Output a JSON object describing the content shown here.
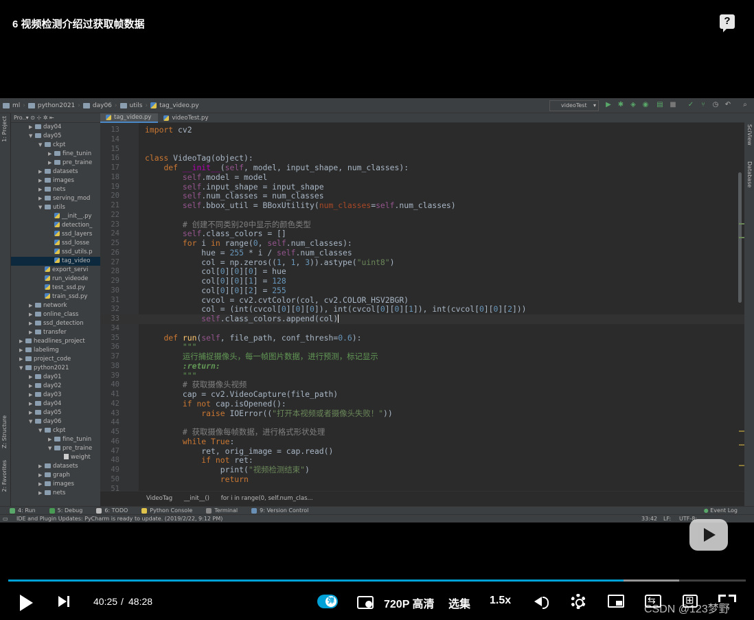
{
  "video": {
    "title": "6 视频检测介绍过获取帧数据",
    "help_label": "?"
  },
  "ide": {
    "breadcrumbs": [
      "ml",
      "python2021",
      "day06",
      "utils",
      "tag_video.py"
    ],
    "run_config": "videoTest",
    "project_header": "Pro..▾",
    "side_tabs": {
      "project": "1: Project",
      "structure": "Z: Structure",
      "favorites": "2: Favorites",
      "sciview": "SciView",
      "database": "Database"
    },
    "tree": [
      {
        "label": "day04",
        "depth": 2,
        "type": "folder",
        "arrow": "▶"
      },
      {
        "label": "day05",
        "depth": 2,
        "type": "folder",
        "arrow": "▼"
      },
      {
        "label": "ckpt",
        "depth": 3,
        "type": "folder",
        "arrow": "▼"
      },
      {
        "label": "fine_tunin",
        "depth": 4,
        "type": "folder",
        "arrow": "▶"
      },
      {
        "label": "pre_traine",
        "depth": 4,
        "type": "folder",
        "arrow": "▶"
      },
      {
        "label": "datasets",
        "depth": 3,
        "type": "folder",
        "arrow": "▶"
      },
      {
        "label": "images",
        "depth": 3,
        "type": "folder",
        "arrow": "▶"
      },
      {
        "label": "nets",
        "depth": 3,
        "type": "folder",
        "arrow": "▶"
      },
      {
        "label": "serving_mod",
        "depth": 3,
        "type": "folder",
        "arrow": "▶"
      },
      {
        "label": "utils",
        "depth": 3,
        "type": "folder",
        "arrow": "▼"
      },
      {
        "label": "__init__.py",
        "depth": 4,
        "type": "py",
        "arrow": ""
      },
      {
        "label": "detection_",
        "depth": 4,
        "type": "py",
        "arrow": ""
      },
      {
        "label": "ssd_layers",
        "depth": 4,
        "type": "py",
        "arrow": ""
      },
      {
        "label": "ssd_losse",
        "depth": 4,
        "type": "py",
        "arrow": ""
      },
      {
        "label": "ssd_utils.p",
        "depth": 4,
        "type": "py",
        "arrow": ""
      },
      {
        "label": "tag_video",
        "depth": 4,
        "type": "py",
        "arrow": "",
        "selected": true
      },
      {
        "label": "export_servi",
        "depth": 3,
        "type": "py",
        "arrow": ""
      },
      {
        "label": "run_videode",
        "depth": 3,
        "type": "py",
        "arrow": ""
      },
      {
        "label": "test_ssd.py",
        "depth": 3,
        "type": "py",
        "arrow": ""
      },
      {
        "label": "train_ssd.py",
        "depth": 3,
        "type": "py",
        "arrow": ""
      },
      {
        "label": "network",
        "depth": 2,
        "type": "folder",
        "arrow": "▶"
      },
      {
        "label": "online_class",
        "depth": 2,
        "type": "folder",
        "arrow": "▶"
      },
      {
        "label": "ssd_detection",
        "depth": 2,
        "type": "folder",
        "arrow": "▶"
      },
      {
        "label": "transfer",
        "depth": 2,
        "type": "folder",
        "arrow": "▶"
      },
      {
        "label": "headlines_project",
        "depth": 1,
        "type": "folder",
        "arrow": "▶"
      },
      {
        "label": "labelimg",
        "depth": 1,
        "type": "folder",
        "arrow": "▶"
      },
      {
        "label": "project_code",
        "depth": 1,
        "type": "folder",
        "arrow": "▶"
      },
      {
        "label": "python2021",
        "depth": 1,
        "type": "folder",
        "arrow": "▼"
      },
      {
        "label": "day01",
        "depth": 2,
        "type": "folder",
        "arrow": "▶"
      },
      {
        "label": "day02",
        "depth": 2,
        "type": "folder",
        "arrow": "▶"
      },
      {
        "label": "day03",
        "depth": 2,
        "type": "folder",
        "arrow": "▶"
      },
      {
        "label": "day04",
        "depth": 2,
        "type": "folder",
        "arrow": "▶"
      },
      {
        "label": "day05",
        "depth": 2,
        "type": "folder",
        "arrow": "▶"
      },
      {
        "label": "day06",
        "depth": 2,
        "type": "folder",
        "arrow": "▼"
      },
      {
        "label": "ckpt",
        "depth": 3,
        "type": "folder",
        "arrow": "▼"
      },
      {
        "label": "fine_tunin",
        "depth": 4,
        "type": "folder",
        "arrow": "▶"
      },
      {
        "label": "pre_traine",
        "depth": 4,
        "type": "folder",
        "arrow": "▼"
      },
      {
        "label": "weight",
        "depth": 5,
        "type": "file",
        "arrow": ""
      },
      {
        "label": "datasets",
        "depth": 3,
        "type": "folder",
        "arrow": "▶"
      },
      {
        "label": "graph",
        "depth": 3,
        "type": "folder",
        "arrow": "▶"
      },
      {
        "label": "images",
        "depth": 3,
        "type": "folder",
        "arrow": "▶"
      },
      {
        "label": "nets",
        "depth": 3,
        "type": "folder",
        "arrow": "▶"
      }
    ],
    "tabs": [
      {
        "label": "tag_video.py",
        "active": true
      },
      {
        "label": "videoTest.py",
        "active": false
      }
    ],
    "code": [
      {
        "n": "13",
        "html": "<span class=\"kw\">import</span> cv2"
      },
      {
        "n": "14",
        "html": ""
      },
      {
        "n": "15",
        "html": ""
      },
      {
        "n": "16",
        "html": "<span class=\"kw\">class</span> VideoTag(object):"
      },
      {
        "n": "17",
        "html": "    <span class=\"kw\">def</span> <span class=\"magic\">__init__</span>(<span class=\"slf\">self</span>, model, input_shape, num_classes):"
      },
      {
        "n": "18",
        "html": "        <span class=\"slf\">self</span>.model = model"
      },
      {
        "n": "19",
        "html": "        <span class=\"slf\">self</span>.input_shape = input_shape"
      },
      {
        "n": "20",
        "html": "        <span class=\"slf\">self</span>.num_classes = num_classes"
      },
      {
        "n": "21",
        "html": "        <span class=\"slf\">self</span>.bbox_util = BBoxUtility(<span class=\"param\">num_classes</span>=<span class=\"slf\">self</span>.num_classes)"
      },
      {
        "n": "22",
        "html": ""
      },
      {
        "n": "23",
        "html": "        <span class=\"cmt\"># 创建不同类别20中显示的颜色类型</span>"
      },
      {
        "n": "24",
        "html": "        <span class=\"slf\">self</span>.class_colors = []"
      },
      {
        "n": "25",
        "html": "        <span class=\"kw\">for</span> i <span class=\"kw\">in</span> range(<span class=\"num\">0</span>, <span class=\"slf\">self</span>.num_classes):"
      },
      {
        "n": "26",
        "html": "            hue = <span class=\"num\">255</span> * i / <span class=\"slf\">self</span>.num_classes"
      },
      {
        "n": "27",
        "html": "            col = np.zeros((<span class=\"num\">1</span>, <span class=\"num\">1</span>, <span class=\"num\">3</span>)).astype(<span class=\"str\">\"uint8\"</span>)"
      },
      {
        "n": "28",
        "html": "            col[<span class=\"num\">0</span>][<span class=\"num\">0</span>][<span class=\"num\">0</span>] = hue"
      },
      {
        "n": "29",
        "html": "            col[<span class=\"num\">0</span>][<span class=\"num\">0</span>][<span class=\"num\">1</span>] = <span class=\"num\">128</span>"
      },
      {
        "n": "30",
        "html": "            col[<span class=\"num\">0</span>][<span class=\"num\">0</span>][<span class=\"num\">2</span>] = <span class=\"num\">255</span>"
      },
      {
        "n": "31",
        "html": "            cvcol = cv2.cvtColor(col, cv2.COLOR_HSV2BGR)"
      },
      {
        "n": "32",
        "html": "            col = (int(cvcol[<span class=\"num\">0</span>][<span class=\"num\">0</span>][<span class=\"num\">0</span>]), int(cvcol[<span class=\"num\">0</span>][<span class=\"num\">0</span>][<span class=\"num\">1</span>]), int(cvcol[<span class=\"num\">0</span>][<span class=\"num\">0</span>][<span class=\"num\">2</span>]))"
      },
      {
        "n": "33",
        "html": "            <span class=\"slf\">self</span>.class_colors.append(col)<span class=\"caret\"></span>",
        "caret": true
      },
      {
        "n": "34",
        "html": ""
      },
      {
        "n": "35",
        "html": "    <span class=\"kw\">def</span> <span class=\"fn\">run</span>(<span class=\"slf\">self</span>, file_path, conf_thresh=<span class=\"num\">0.6</span>):"
      },
      {
        "n": "36",
        "html": "        <span class=\"doc\">\"\"\"</span>"
      },
      {
        "n": "37",
        "html": "        <span class=\"doc\">运行捕捉摄像头，每一帧图片数据，进行预测，标记显示</span>"
      },
      {
        "n": "38",
        "html": "        <span class=\"docb\">:return:</span>"
      },
      {
        "n": "39",
        "html": "        <span class=\"doc\">\"\"\"</span>"
      },
      {
        "n": "40",
        "html": "        <span class=\"cmt\"># 获取摄像头视频</span>"
      },
      {
        "n": "41",
        "html": "        cap = cv2.VideoCapture(file_path)"
      },
      {
        "n": "42",
        "html": "        <span class=\"kw\">if not</span> cap.isOpened():"
      },
      {
        "n": "43",
        "html": "            <span class=\"kw\">raise</span> IOError((<span class=\"str\">\"打开本视频或者摄像头失败！\"</span>))"
      },
      {
        "n": "44",
        "html": ""
      },
      {
        "n": "45",
        "html": "        <span class=\"cmt\"># 获取摄像每帧数据，进行格式形状处理</span>"
      },
      {
        "n": "46",
        "html": "        <span class=\"kw\">while True</span>:"
      },
      {
        "n": "47",
        "html": "            ret, orig_image = cap.read()"
      },
      {
        "n": "48",
        "html": "            <span class=\"kw\">if not</span> ret:"
      },
      {
        "n": "49",
        "html": "                print(<span class=\"str\">\"视频检测结束\"</span>)"
      },
      {
        "n": "50",
        "html": "                <span class=\"kw\">return</span>"
      },
      {
        "n": "51",
        "html": ""
      }
    ],
    "editor_breadcrumb": [
      "VideoTag",
      "__init__()",
      "for i in range(0, self.num_clas..."
    ],
    "tool_windows": [
      {
        "label": "4: Run",
        "color": "#59a869"
      },
      {
        "label": "5: Debug",
        "color": "#499c54"
      },
      {
        "label": "6: TODO",
        "color": "#bbbbbb"
      },
      {
        "label": "Python Console",
        "color": "#e0c34a"
      },
      {
        "label": "Terminal",
        "color": "#888888"
      },
      {
        "label": "9: Version Control",
        "color": "#6a8fb5"
      }
    ],
    "event_log": "Event Log",
    "status_message": "IDE and Plugin Updates: PyCharm is ready to update. (2019/2/22, 9:12 PM)",
    "cursor_pos": "33:42",
    "line_sep": "LF:",
    "encoding": "UTF-8:"
  },
  "player": {
    "progress": 0.834,
    "buffered": 0.91,
    "time_current": "40:25",
    "time_sep": "/",
    "time_total": "48:28",
    "danmaku_label": "弹",
    "quality": "720P 高清",
    "episodes": "选集",
    "speed": "1.5x",
    "watermark": "CSDN @123梦野",
    "accent_color": "#00a1d6"
  }
}
